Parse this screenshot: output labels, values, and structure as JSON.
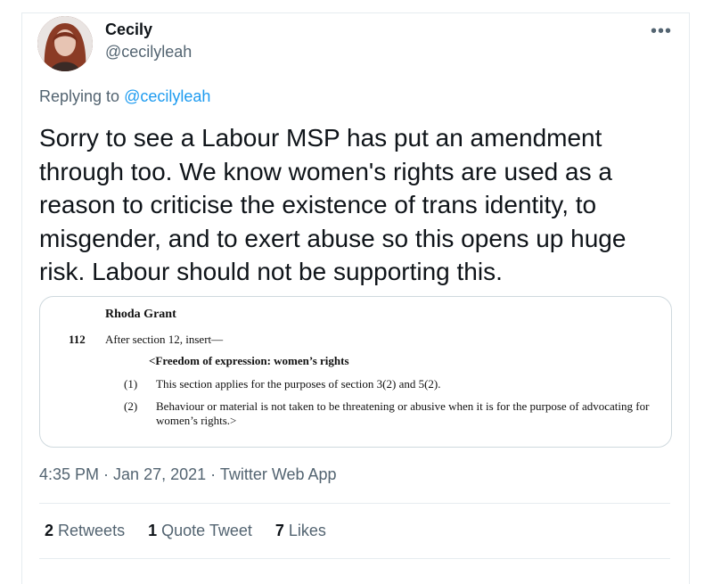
{
  "author": {
    "display_name": "Cecily",
    "handle": "@cecilyleah"
  },
  "more_icon": "more-horizontal-icon",
  "replying": {
    "prefix": "Replying to",
    "handle": "@cecilyleah"
  },
  "tweet_text": "Sorry to see a Labour MSP has put an amendment through too. We know women's rights are used as a reason to criticise the existence of trans identity, to misgender, and to exert abuse so this opens up huge risk. Labour should not be supporting this.",
  "image_text": {
    "name": "Rhoda Grant",
    "number": "112",
    "insert": "After section 12, insert—",
    "heading": "<Freedom of expression: women’s rights",
    "sub1_num": "(1)",
    "sub1": "This section applies for the purposes of section 3(2) and 5(2).",
    "sub2_num": "(2)",
    "sub2": "Behaviour or material is not taken to be threatening or abusive when it is for the purpose of advocating for women’s rights.>"
  },
  "meta": {
    "time": "4:35 PM",
    "sep1": " · ",
    "date": "Jan 27, 2021",
    "sep2": " · ",
    "app": "Twitter Web App"
  },
  "stats": {
    "retweets_count": "2",
    "retweets_label": "Retweets",
    "quotes_count": "1",
    "quotes_label": "Quote Tweet",
    "likes_count": "7",
    "likes_label": "Likes"
  },
  "colors": {
    "link": "#1d9bf0",
    "secondary_text": "#536471",
    "primary_text": "#0f1419",
    "border": "#e6ecf0"
  }
}
